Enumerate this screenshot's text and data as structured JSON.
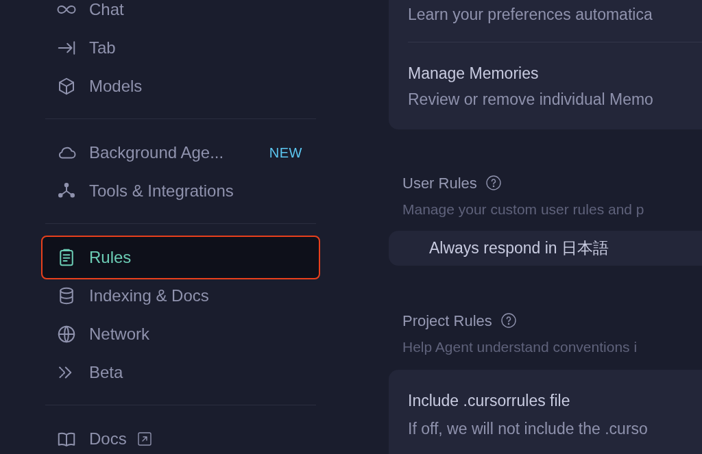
{
  "sidebar": {
    "groups": [
      [
        {
          "label": "Chat",
          "selected": false
        },
        {
          "label": "Tab",
          "selected": false
        },
        {
          "label": "Models",
          "selected": false
        }
      ],
      [
        {
          "label": "Background Age...",
          "selected": false,
          "badge": "NEW"
        },
        {
          "label": "Tools & Integrations",
          "selected": false
        }
      ],
      [
        {
          "label": "Rules",
          "selected": true
        },
        {
          "label": "Indexing & Docs",
          "selected": false
        },
        {
          "label": "Network",
          "selected": false
        },
        {
          "label": "Beta",
          "selected": false
        }
      ],
      [
        {
          "label": "Docs",
          "selected": false,
          "external": true
        }
      ]
    ]
  },
  "memories_card": {
    "rows": [
      {
        "description": "Learn your preferences automatica"
      },
      {
        "title": "Manage Memories",
        "description": "Review or remove individual Memo"
      }
    ]
  },
  "user_rules": {
    "title": "User Rules",
    "description": "Manage your custom user rules and p",
    "rules": [
      "Always respond in 日本語"
    ]
  },
  "project_rules": {
    "title": "Project Rules",
    "description": "Help Agent understand conventions i",
    "settings": [
      {
        "title": "Include .cursorrules file",
        "description": "If off, we will not include the .curso"
      }
    ]
  }
}
